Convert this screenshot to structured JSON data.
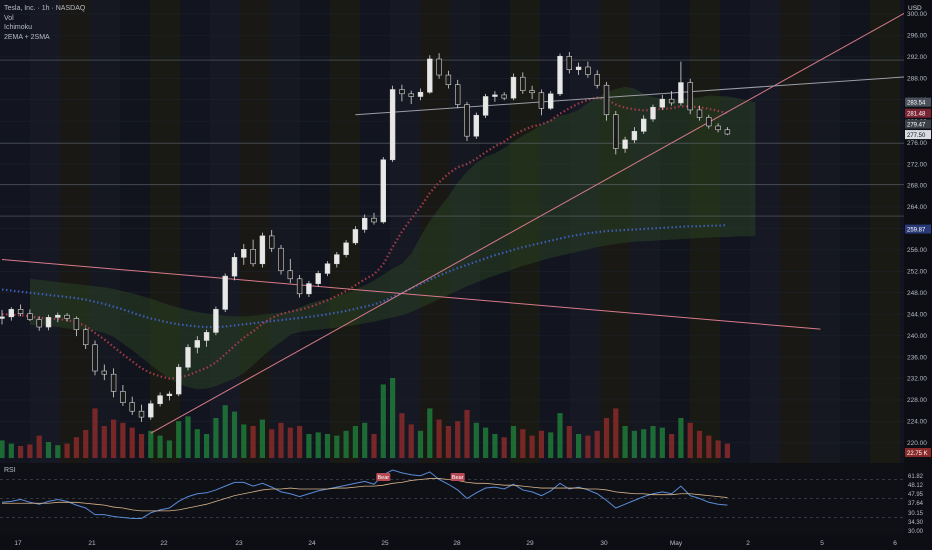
{
  "legend": {
    "symbol_line": "Tesla, Inc. · 1h · NASDAQ",
    "lines": [
      "Vol",
      "Ichimoku",
      "2EMA + 2SMA"
    ]
  },
  "rsi_title": "RSI",
  "currency": "USD",
  "colors": {
    "background": "#0c0e13",
    "candle_up": "#e8e8e8",
    "candle_down": "#1a1a1a",
    "vol_up": "#1f7a3a",
    "vol_down": "#8a2a2a",
    "ema_short": "#a33b4b",
    "ema_long": "#3f5db8",
    "trendline": "#d97a8a",
    "rsi_line": "#5a8bd6",
    "rsi_ma": "#d9b38a",
    "bear_label": "#b74a55"
  },
  "chart_data": {
    "type": "candlestick",
    "symbol": "Tesla, Inc.",
    "interval": "1h",
    "exchange": "NASDAQ",
    "x_tick_labels": [
      "17",
      "21",
      "22",
      "23",
      "24",
      "25",
      "28",
      "29",
      "30",
      "May",
      "2",
      "5",
      "6"
    ],
    "y_ticks": [
      220,
      224,
      228,
      232,
      236,
      240,
      244,
      248,
      252,
      256,
      260,
      264,
      268,
      272,
      276,
      280,
      284,
      288,
      292,
      296,
      300
    ],
    "ylim": [
      216.8,
      302.6
    ],
    "price_labels": [
      {
        "text": "283.54",
        "value": 283.54,
        "color": "#4a4f5c"
      },
      {
        "text": "281.48",
        "value": 281.48,
        "color": "#7a2333"
      },
      {
        "text": "279.47",
        "value": 279.47,
        "color": "#3b4048"
      },
      {
        "text": "277.50",
        "value": 277.5,
        "color": "#d9dce3"
      },
      {
        "text": "259.87",
        "value": 259.87,
        "color": "#2a3a78"
      },
      {
        "text": "22.75 K",
        "value": 218.2,
        "color": "#8a2a2a"
      }
    ],
    "horizontal_levels": [
      291.4,
      275.9,
      268.2,
      262.3
    ],
    "ohlc": [
      [
        243.2,
        244.8,
        242.1,
        243.5
      ],
      [
        243.5,
        245.3,
        242.8,
        244.9
      ],
      [
        244.9,
        245.8,
        243.6,
        244.1
      ],
      [
        244.1,
        244.9,
        242.7,
        243.0
      ],
      [
        243.0,
        243.6,
        240.9,
        241.6
      ],
      [
        241.6,
        243.9,
        241.0,
        243.4
      ],
      [
        243.4,
        244.3,
        242.5,
        243.8
      ],
      [
        243.8,
        244.2,
        242.6,
        243.2
      ],
      [
        243.2,
        243.6,
        239.9,
        241.1
      ],
      [
        241.1,
        241.5,
        237.5,
        238.3
      ],
      [
        238.3,
        239.1,
        232.6,
        233.4
      ],
      [
        233.4,
        234.6,
        231.7,
        232.8
      ],
      [
        232.8,
        233.9,
        228.5,
        229.6
      ],
      [
        229.6,
        230.8,
        226.9,
        227.5
      ],
      [
        227.5,
        228.6,
        225.2,
        225.9
      ],
      [
        225.9,
        227.1,
        223.9,
        224.8
      ],
      [
        224.8,
        227.9,
        224.3,
        227.3
      ],
      [
        227.3,
        229.4,
        226.8,
        228.8
      ],
      [
        228.8,
        229.6,
        227.9,
        229.1
      ],
      [
        229.1,
        234.7,
        228.7,
        234.1
      ],
      [
        234.1,
        238.4,
        233.5,
        237.8
      ],
      [
        237.8,
        239.9,
        236.7,
        239.1
      ],
      [
        239.1,
        241.1,
        237.9,
        240.6
      ],
      [
        240.6,
        245.4,
        240.1,
        244.9
      ],
      [
        244.9,
        251.6,
        244.4,
        251.1
      ],
      [
        251.1,
        255.4,
        250.3,
        254.6
      ],
      [
        254.6,
        257.1,
        253.2,
        256.1
      ],
      [
        256.1,
        257.9,
        252.9,
        253.4
      ],
      [
        253.4,
        259.2,
        252.7,
        258.6
      ],
      [
        258.6,
        259.7,
        255.6,
        256.3
      ],
      [
        256.3,
        256.9,
        251.4,
        252.1
      ],
      [
        252.1,
        254.3,
        249.8,
        250.6
      ],
      [
        250.6,
        251.3,
        247.1,
        247.8
      ],
      [
        247.8,
        250.2,
        247.2,
        249.7
      ],
      [
        249.7,
        252.1,
        249.1,
        251.6
      ],
      [
        251.6,
        253.9,
        251.1,
        253.4
      ],
      [
        253.4,
        255.6,
        252.7,
        255.1
      ],
      [
        255.1,
        257.8,
        254.6,
        257.3
      ],
      [
        257.3,
        260.4,
        256.9,
        259.8
      ],
      [
        259.8,
        262.6,
        259.2,
        261.9
      ],
      [
        261.9,
        262.9,
        260.7,
        261.2
      ],
      [
        261.2,
        273.3,
        260.9,
        272.8
      ],
      [
        272.8,
        286.6,
        272.4,
        285.9
      ],
      [
        285.9,
        286.8,
        283.7,
        285.1
      ],
      [
        285.1,
        285.7,
        283.2,
        284.6
      ],
      [
        284.6,
        286.1,
        283.9,
        285.4
      ],
      [
        285.4,
        292.3,
        285.1,
        291.6
      ],
      [
        291.6,
        292.7,
        287.9,
        288.6
      ],
      [
        288.6,
        289.4,
        286.1,
        286.8
      ],
      [
        286.8,
        287.7,
        282.4,
        283.1
      ],
      [
        283.1,
        283.6,
        276.3,
        277.2
      ],
      [
        277.2,
        281.6,
        276.7,
        281.1
      ],
      [
        281.1,
        285.1,
        280.6,
        284.6
      ],
      [
        284.6,
        285.6,
        283.6,
        284.9
      ],
      [
        284.9,
        285.4,
        283.9,
        284.3
      ],
      [
        284.3,
        288.9,
        283.9,
        288.2
      ],
      [
        288.2,
        289.1,
        285.1,
        285.7
      ],
      [
        285.7,
        286.6,
        284.1,
        285.3
      ],
      [
        285.3,
        285.9,
        281.1,
        282.4
      ],
      [
        282.4,
        285.6,
        282.1,
        285.1
      ],
      [
        285.1,
        292.6,
        284.7,
        292.1
      ],
      [
        292.1,
        292.9,
        288.9,
        289.6
      ],
      [
        289.6,
        290.9,
        288.6,
        290.1
      ],
      [
        290.1,
        291.1,
        288.1,
        288.7
      ],
      [
        288.7,
        289.5,
        286.1,
        286.7
      ],
      [
        286.7,
        287.3,
        280.1,
        281.2
      ],
      [
        281.2,
        281.9,
        273.8,
        274.9
      ],
      [
        274.9,
        277.1,
        274.1,
        276.5
      ],
      [
        276.5,
        278.9,
        275.9,
        278.1
      ],
      [
        278.1,
        281.1,
        277.6,
        280.4
      ],
      [
        280.4,
        283.1,
        279.9,
        282.6
      ],
      [
        282.6,
        284.9,
        282.1,
        284.1
      ],
      [
        284.1,
        285.6,
        282.9,
        283.4
      ],
      [
        283.4,
        291.1,
        282.9,
        287.2
      ],
      [
        287.2,
        287.9,
        281.3,
        282.1
      ],
      [
        282.1,
        282.9,
        280.1,
        280.7
      ],
      [
        280.7,
        281.2,
        278.6,
        279.1
      ],
      [
        279.1,
        279.6,
        277.9,
        278.4
      ],
      [
        278.4,
        278.9,
        277.4,
        277.6
      ]
    ],
    "volume": [
      0.22,
      0.18,
      0.15,
      0.17,
      0.28,
      0.2,
      0.16,
      0.18,
      0.26,
      0.35,
      0.62,
      0.4,
      0.48,
      0.44,
      0.38,
      0.3,
      0.34,
      0.28,
      0.22,
      0.46,
      0.52,
      0.36,
      0.3,
      0.5,
      0.66,
      0.58,
      0.42,
      0.4,
      0.48,
      0.36,
      0.44,
      0.38,
      0.4,
      0.3,
      0.32,
      0.3,
      0.28,
      0.34,
      0.4,
      0.44,
      0.3,
      0.92,
      1.0,
      0.56,
      0.42,
      0.34,
      0.62,
      0.48,
      0.4,
      0.46,
      0.6,
      0.44,
      0.38,
      0.3,
      0.26,
      0.4,
      0.36,
      0.28,
      0.34,
      0.32,
      0.56,
      0.4,
      0.3,
      0.28,
      0.34,
      0.5,
      0.62,
      0.4,
      0.34,
      0.36,
      0.4,
      0.38,
      0.3,
      0.5,
      0.44,
      0.34,
      0.28,
      0.22,
      0.18
    ],
    "ema_short": [
      244.0,
      243.9,
      243.8,
      243.6,
      243.3,
      243.2,
      243.1,
      242.9,
      242.5,
      241.8,
      240.5,
      239.3,
      237.9,
      236.5,
      235.2,
      233.9,
      233.0,
      232.4,
      232.0,
      232.1,
      232.6,
      233.3,
      234.0,
      235.0,
      236.5,
      238.1,
      239.6,
      240.8,
      242.2,
      243.3,
      244.0,
      244.5,
      244.8,
      245.3,
      245.9,
      246.6,
      247.4,
      248.3,
      249.4,
      250.5,
      251.4,
      253.3,
      256.5,
      259.4,
      261.8,
      264.0,
      266.6,
      268.6,
      270.2,
      271.4,
      272.0,
      273.0,
      274.2,
      275.3,
      276.2,
      277.4,
      278.3,
      279.0,
      279.4,
      280.1,
      281.4,
      282.4,
      283.3,
      284.0,
      284.4,
      284.1,
      283.1,
      282.5,
      282.2,
      282.0,
      282.1,
      282.3,
      282.4,
      282.8,
      282.7,
      282.6,
      282.3,
      281.9,
      281.5
    ],
    "ema_long": [
      248.6,
      248.4,
      248.2,
      248.0,
      247.8,
      247.6,
      247.4,
      247.2,
      247.0,
      246.7,
      246.3,
      245.9,
      245.4,
      244.9,
      244.3,
      243.7,
      243.2,
      242.8,
      242.4,
      242.1,
      241.9,
      241.7,
      241.6,
      241.6,
      241.7,
      241.9,
      242.1,
      242.3,
      242.5,
      242.7,
      242.9,
      243.1,
      243.3,
      243.5,
      243.7,
      244.0,
      244.3,
      244.6,
      245.0,
      245.4,
      245.8,
      246.4,
      247.2,
      248.0,
      248.8,
      249.6,
      250.4,
      251.2,
      251.9,
      252.6,
      253.2,
      253.8,
      254.4,
      255.0,
      255.5,
      256.0,
      256.5,
      256.9,
      257.3,
      257.7,
      258.1,
      258.5,
      258.8,
      259.1,
      259.3,
      259.5,
      259.6,
      259.7,
      259.8,
      259.9,
      260.0,
      260.1,
      260.2,
      260.3,
      260.4,
      260.4,
      260.5,
      260.5,
      260.6
    ],
    "trendlines": [
      {
        "from": [
          0,
          254.2
        ],
        "to": [
          88,
          241.2
        ],
        "note": "descending"
      },
      {
        "from": [
          16,
          221.8
        ],
        "to": [
          100,
          303.0
        ],
        "note": "ascending"
      },
      {
        "from": [
          38,
          281.2
        ],
        "to": [
          100,
          288.6
        ],
        "note": "upper"
      }
    ],
    "rsi": {
      "ylim": [
        20,
        80
      ],
      "levels": [
        70,
        50,
        30
      ],
      "tick_labels": [
        "61.82",
        "48.12",
        "47.95",
        "37.64",
        "30.15",
        "34.30",
        "30.00"
      ],
      "labels": [
        "Bear",
        "Bear"
      ],
      "values": [
        46,
        47,
        49,
        46,
        44,
        47,
        49,
        47,
        43,
        40,
        33,
        33,
        31,
        30,
        29,
        29,
        35,
        38,
        40,
        47,
        52,
        55,
        56,
        59,
        63,
        67,
        67,
        63,
        66,
        62,
        57,
        55,
        52,
        55,
        58,
        60,
        62,
        64,
        66,
        68,
        65,
        75,
        80,
        77,
        75,
        74,
        78,
        70,
        65,
        59,
        50,
        56,
        61,
        62,
        60,
        65,
        59,
        57,
        53,
        58,
        66,
        60,
        62,
        59,
        55,
        48,
        40,
        44,
        48,
        52,
        55,
        57,
        55,
        63,
        53,
        50,
        46,
        44,
        43
      ],
      "ma": [
        45,
        45,
        45,
        45,
        45,
        45,
        46,
        46,
        46,
        45,
        44,
        43,
        41,
        40,
        38,
        37,
        37,
        37,
        37,
        38,
        40,
        42,
        44,
        47,
        50,
        53,
        55,
        57,
        59,
        60,
        60,
        61,
        60,
        60,
        60,
        60,
        61,
        61,
        62,
        63,
        63,
        64,
        66,
        67,
        69,
        70,
        71,
        71,
        70,
        69,
        67,
        66,
        66,
        65,
        64,
        64,
        63,
        62,
        61,
        61,
        61,
        61,
        61,
        60,
        60,
        59,
        57,
        56,
        55,
        55,
        54,
        54,
        54,
        55,
        55,
        54,
        53,
        52,
        51
      ]
    }
  }
}
